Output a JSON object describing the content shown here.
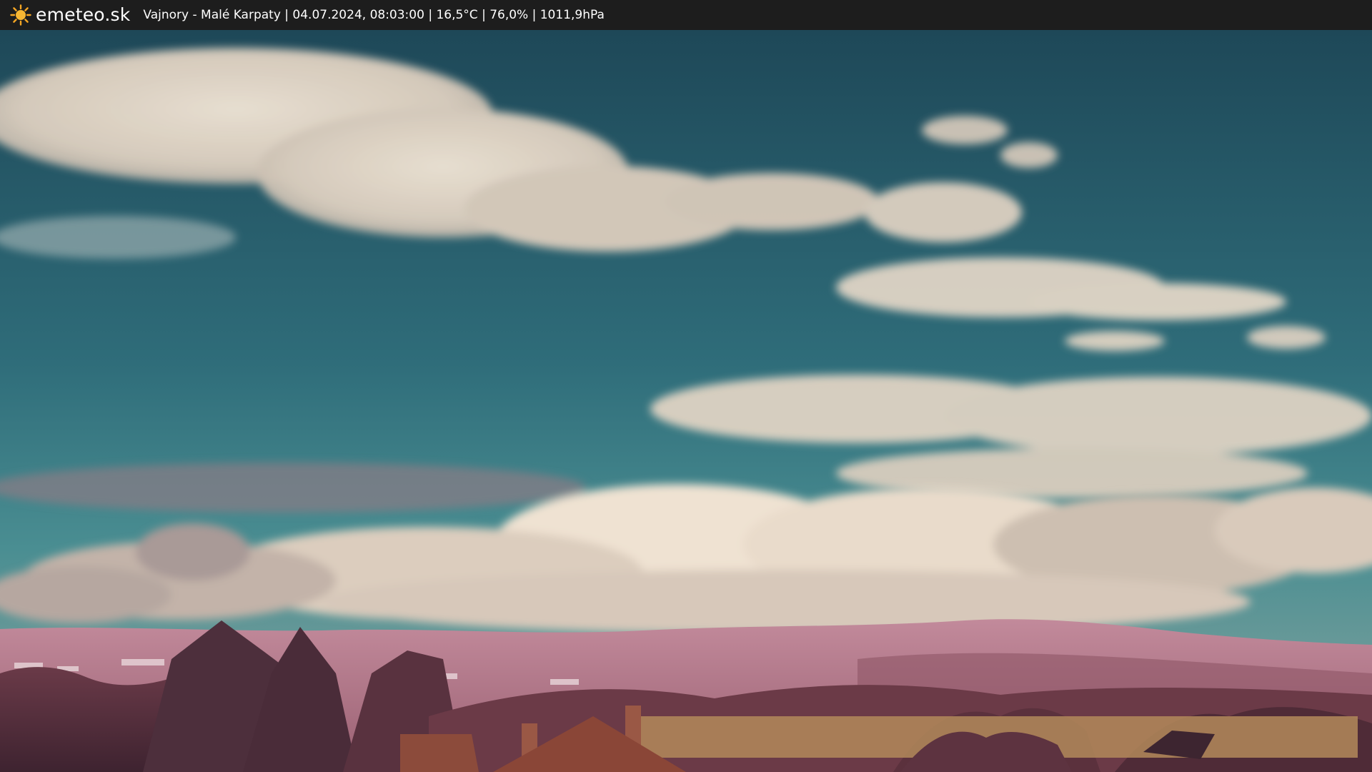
{
  "header": {
    "logo_icon": "sun-icon",
    "logo_text": "emeteo.sk",
    "caption": "Vajnory - Malé Karpaty | 04.07.2024, 08:03:00 | 16,5°C | 76,0% | 1011,9hPa"
  },
  "colors": {
    "bar_background": "#1d1d1d",
    "sun": "#f5a623",
    "sky_top": "#1f4a5a",
    "sky_bottom": "#3f8a92",
    "cloud": "#e4d6c6",
    "hills": "#b77a8e",
    "trees": "#5a3340",
    "roofs": "#8a4b3a"
  },
  "scene": {
    "description_icon": "webcam-image"
  }
}
